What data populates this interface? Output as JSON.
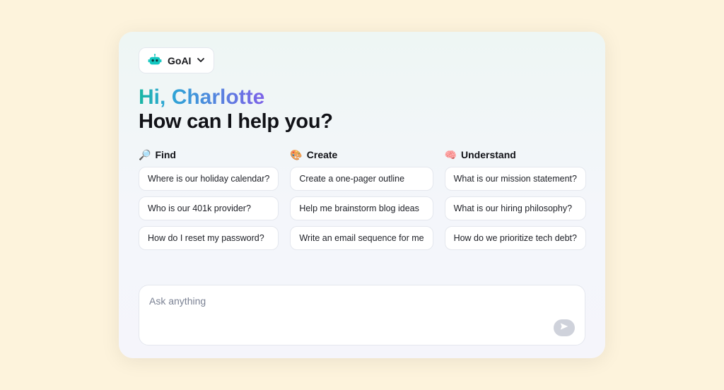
{
  "model": {
    "name": "GoAI"
  },
  "greeting": {
    "hi": "Hi,",
    "name": "Charlotte",
    "sub": "How can I help you?"
  },
  "columns": [
    {
      "icon": "🔎",
      "title": "Find",
      "items": [
        "Where is our holiday calendar?",
        "Who is our 401k provider?",
        "How do I reset my password?"
      ]
    },
    {
      "icon": "🎨",
      "title": "Create",
      "items": [
        "Create a one-pager outline",
        "Help me brainstorm blog ideas",
        "Write an email sequence for me"
      ]
    },
    {
      "icon": "🧠",
      "title": "Understand",
      "items": [
        "What is our mission statement?",
        "What is our hiring philosophy?",
        "How do we prioritize tech debt?"
      ]
    }
  ],
  "input": {
    "placeholder": "Ask anything"
  }
}
